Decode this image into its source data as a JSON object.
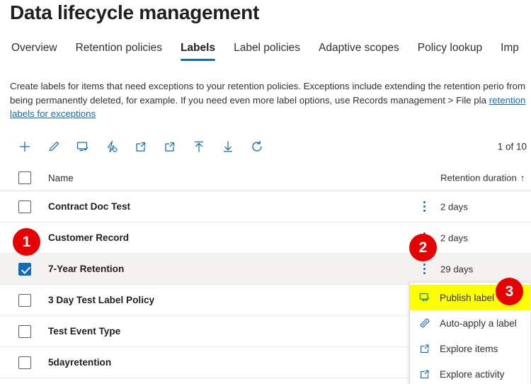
{
  "page": {
    "title": "Data lifecycle management"
  },
  "tabs": [
    {
      "label": "Overview",
      "active": false
    },
    {
      "label": "Retention policies",
      "active": false
    },
    {
      "label": "Labels",
      "active": true
    },
    {
      "label": "Label policies",
      "active": false
    },
    {
      "label": "Adaptive scopes",
      "active": false
    },
    {
      "label": "Policy lookup",
      "active": false
    },
    {
      "label": "Imp",
      "active": false
    }
  ],
  "description": {
    "text": "Create labels for items that need exceptions to your retention policies. Exceptions include extending the retention perio from being permanently deleted, for example. If you need even more label options, use Records management > File pla",
    "link": "retention labels for exceptions"
  },
  "toolbar": {
    "items": [
      {
        "name": "new-label-button",
        "icon": "plus-icon",
        "tooltip": "New label"
      },
      {
        "name": "edit-button",
        "icon": "pencil-icon",
        "tooltip": "Edit"
      },
      {
        "name": "publish-label-button",
        "icon": "publish-monitor-icon",
        "tooltip": "Publish label"
      },
      {
        "name": "auto-apply-button",
        "icon": "auto-apply-bolt-icon",
        "tooltip": "Auto-apply a label"
      },
      {
        "name": "explore-items-button",
        "icon": "external-link-icon",
        "tooltip": "Explore items"
      },
      {
        "name": "explore-activity-button",
        "icon": "external-link-icon",
        "tooltip": "Explore activity"
      },
      {
        "name": "export-button",
        "icon": "arrow-up-icon",
        "tooltip": "Export"
      },
      {
        "name": "import-button",
        "icon": "arrow-down-icon",
        "tooltip": "Import"
      },
      {
        "name": "refresh-button",
        "icon": "refresh-icon",
        "tooltip": "Refresh"
      }
    ],
    "count_label": "1 of 10"
  },
  "table": {
    "columns": {
      "name": "Name",
      "retention": "Retention duration",
      "sort_indicator": "↑"
    },
    "rows": [
      {
        "name": "Contract Doc Test",
        "retention": "2 days",
        "checked": false,
        "selected": false
      },
      {
        "name": "Customer Record",
        "retention": "2 days",
        "checked": false,
        "selected": false
      },
      {
        "name": "7-Year Retention",
        "retention": "29 days",
        "checked": true,
        "selected": true
      },
      {
        "name": "3 Day Test Label Policy",
        "retention": "",
        "checked": false,
        "selected": false
      },
      {
        "name": "Test Event Type",
        "retention": "",
        "checked": false,
        "selected": false
      },
      {
        "name": "5dayretention",
        "retention": "",
        "checked": false,
        "selected": false
      }
    ]
  },
  "context_menu": {
    "items": [
      {
        "label": "Publish label",
        "icon": "publish-monitor-icon",
        "highlighted": true
      },
      {
        "label": "Auto-apply a label",
        "icon": "auto-apply-tag-icon",
        "highlighted": false
      },
      {
        "label": "Explore items",
        "icon": "external-link-icon",
        "highlighted": false
      },
      {
        "label": "Explore activity",
        "icon": "external-link-icon",
        "highlighted": false
      }
    ]
  },
  "annotations": [
    {
      "id": 1,
      "label": "1"
    },
    {
      "id": 2,
      "label": "2"
    },
    {
      "id": 3,
      "label": "3"
    }
  ],
  "colors": {
    "accent": "#0f6cbd",
    "badge_red": "#e60000",
    "highlight_yellow": "#ffff00",
    "selected_row": "#f3f2f1"
  }
}
